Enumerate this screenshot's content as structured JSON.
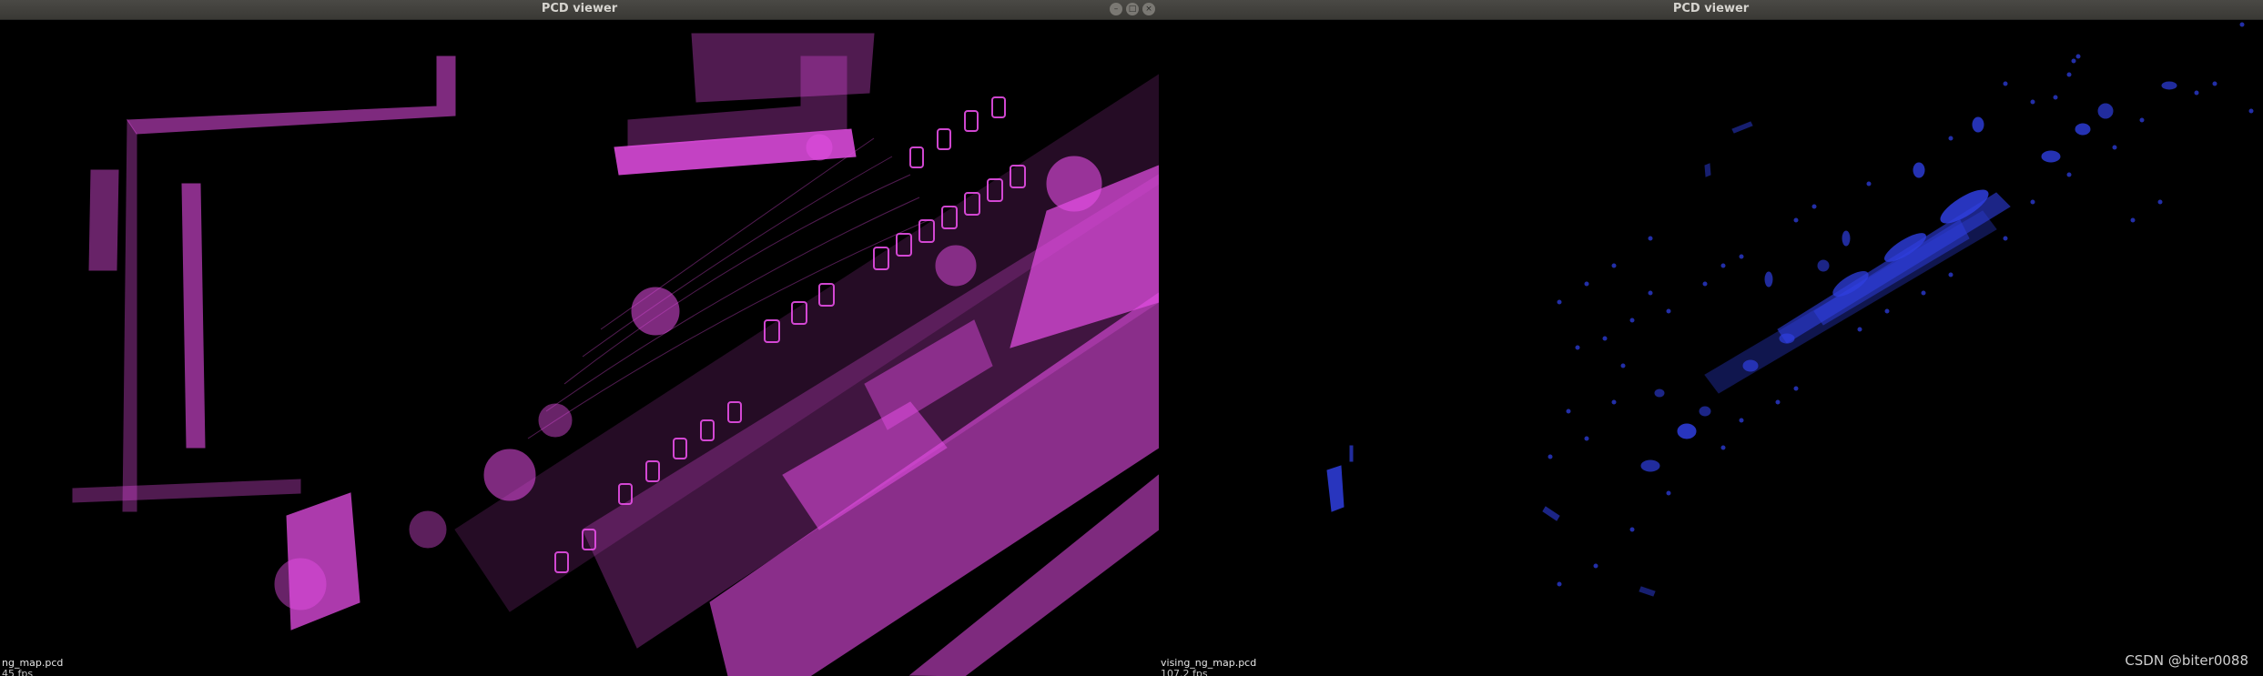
{
  "windows": [
    {
      "title": "PCD viewer",
      "controls": [
        "minimize-icon",
        "maximize-icon",
        "close-icon"
      ],
      "point_color": "#e64ee6",
      "fps_text": "45 fps",
      "file_label": "ng_map.pcd"
    },
    {
      "title": "PCD viewer",
      "point_color": "#2f3fe0",
      "fps_text": "107.2 fps",
      "file_label": "vising_ng_map.pcd"
    }
  ],
  "watermark": "CSDN @biter0088",
  "colors": {
    "background": "#000000",
    "titlebar": "#3f3e3a",
    "title_text": "#d6d4cf"
  }
}
